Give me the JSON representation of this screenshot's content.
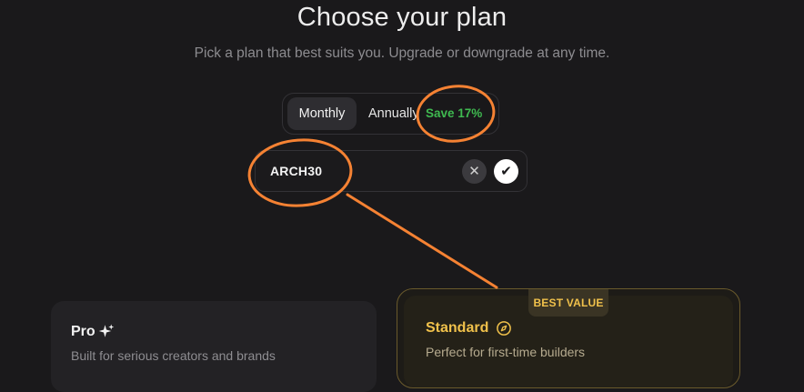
{
  "header": {
    "title": "Choose your plan",
    "subtitle": "Pick a plan that best suits you. Upgrade or downgrade at any time."
  },
  "billing_toggle": {
    "monthly_label": "Monthly",
    "annually_label": "Annually",
    "save_label": "Save 17%",
    "selected": "Monthly"
  },
  "coupon": {
    "value": "ARCH30",
    "clear_icon": "close-icon",
    "apply_icon": "check-icon"
  },
  "plans": [
    {
      "name": "Pro",
      "icon": "sparkle-icon",
      "description": "Built for serious creators and brands"
    },
    {
      "name": "Standard",
      "icon": "compass-icon",
      "description": "Perfect for first-time builders",
      "badge": "BEST VALUE"
    }
  ],
  "colors": {
    "background": "#1a191b",
    "accent_gold": "#f0c14b",
    "save_green": "#3fb950",
    "annotation_orange": "#f58233"
  }
}
